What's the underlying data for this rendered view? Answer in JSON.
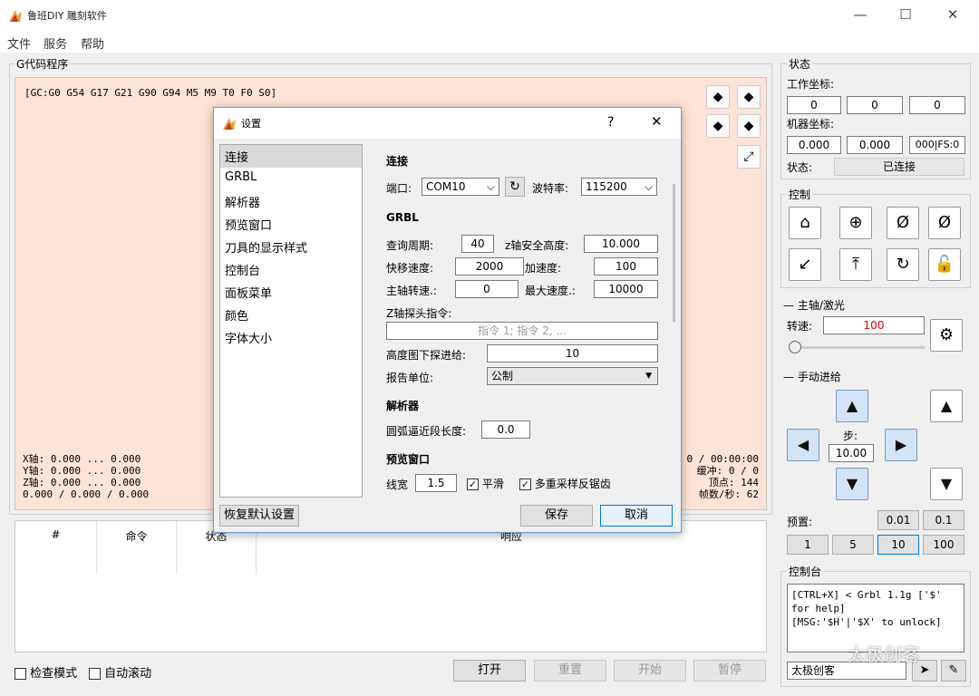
{
  "window": {
    "title": "鲁班DIY 雕刻软件",
    "minimize": "—",
    "maximize": "☐",
    "close": "✕"
  },
  "menu": [
    "文件",
    "服务",
    "帮助"
  ],
  "gcode": {
    "group_title": "G代码程序",
    "status_line": "[GC:G0 G54 G17 G21 G90 G94 M5 M9 T0 F0 S0]",
    "axis_x": "X轴: 0.000 ... 0.000",
    "axis_y": "Y轴: 0.000 ... 0.000",
    "axis_z": "Z轴: 0.000 ... 0.000",
    "axis_size": "0.000 / 0.000 / 0.000",
    "time": "0 / 00:00:00",
    "buffer": "缓冲: 0 / 0",
    "vertices": "顶点: 144",
    "fps": "帧数/秒: 62"
  },
  "table": {
    "col_num": "#",
    "col_cmd": "命令",
    "col_state": "状态",
    "col_resp": "响应"
  },
  "bottom": {
    "check_mode": "检查模式",
    "auto_scroll": "自动滚动",
    "open": "打开",
    "reset": "重置",
    "start": "开始",
    "pause": "暂停"
  },
  "status": {
    "title": "状态",
    "work_label": "工作坐标:",
    "work": [
      "0",
      "0",
      "0"
    ],
    "machine_label": "机器坐标:",
    "machine": [
      "0.000",
      "0.000",
      "000|FS:0"
    ],
    "state_label": "状态:",
    "state": "已连接"
  },
  "control": {
    "title": "控制"
  },
  "spindle": {
    "title": "主轴/激光",
    "speed_label": "转速:",
    "speed": "100"
  },
  "jog": {
    "title": "手动进给",
    "step_label": "步:",
    "step": "10.00",
    "preset_label": "预置:",
    "presets_top": [
      "0.01",
      "0.1"
    ],
    "presets_bottom": [
      "1",
      "5",
      "10",
      "100"
    ]
  },
  "console": {
    "title": "控制台",
    "lines": [
      "[CTRL+X] < Grbl 1.1g ['$'",
      "for help]",
      "[MSG:'$H'|'$X' to unlock]"
    ],
    "input": "太极创客"
  },
  "watermark": "太极创客",
  "dialog": {
    "title": "设置",
    "help": "?",
    "close": "✕",
    "nav": [
      "连接",
      "GRBL",
      "解析器",
      "预览窗口",
      "刀具的显示样式",
      "控制台",
      "面板菜单",
      "颜色",
      "字体大小"
    ],
    "conn_title": "连接",
    "port_label": "端口:",
    "port": "COM10",
    "baud_label": "波特率:",
    "baud": "115200",
    "grbl_title": "GRBL",
    "query_label": "查询周期:",
    "query": "40",
    "zsafe_label": "z轴安全高度:",
    "zsafe": "10.000",
    "rapid_label": "快移速度:",
    "rapid": "2000",
    "accel_label": "加速度:",
    "accel": "100",
    "spindle_label": "主轴转速.:",
    "spindle_val": "0",
    "maxspeed_label": "最大速度.:",
    "maxspeed": "10000",
    "probe_label": "Z轴探头指令:",
    "probe_placeholder": "指令 1; 指令 2, ...",
    "probe_feed_label": "高度图下探进给:",
    "probe_feed": "10",
    "units_label": "报告单位:",
    "units": "公制",
    "parser_title": "解析器",
    "arc_label": "圆弧逼近段长度:",
    "arc": "0.0",
    "preview_title": "预览窗口",
    "line_label": "线宽",
    "line": "1.5",
    "smooth": "平滑",
    "msaa": "多重采样反锯齿",
    "restore": "恢复默认设置",
    "save": "保存",
    "cancel": "取消"
  },
  "colors": {
    "accent": "#0078d7",
    "gcode_bg": "#fde4d8",
    "jog_blue": "#d3e3f5",
    "spindle_red": "#e00000"
  }
}
